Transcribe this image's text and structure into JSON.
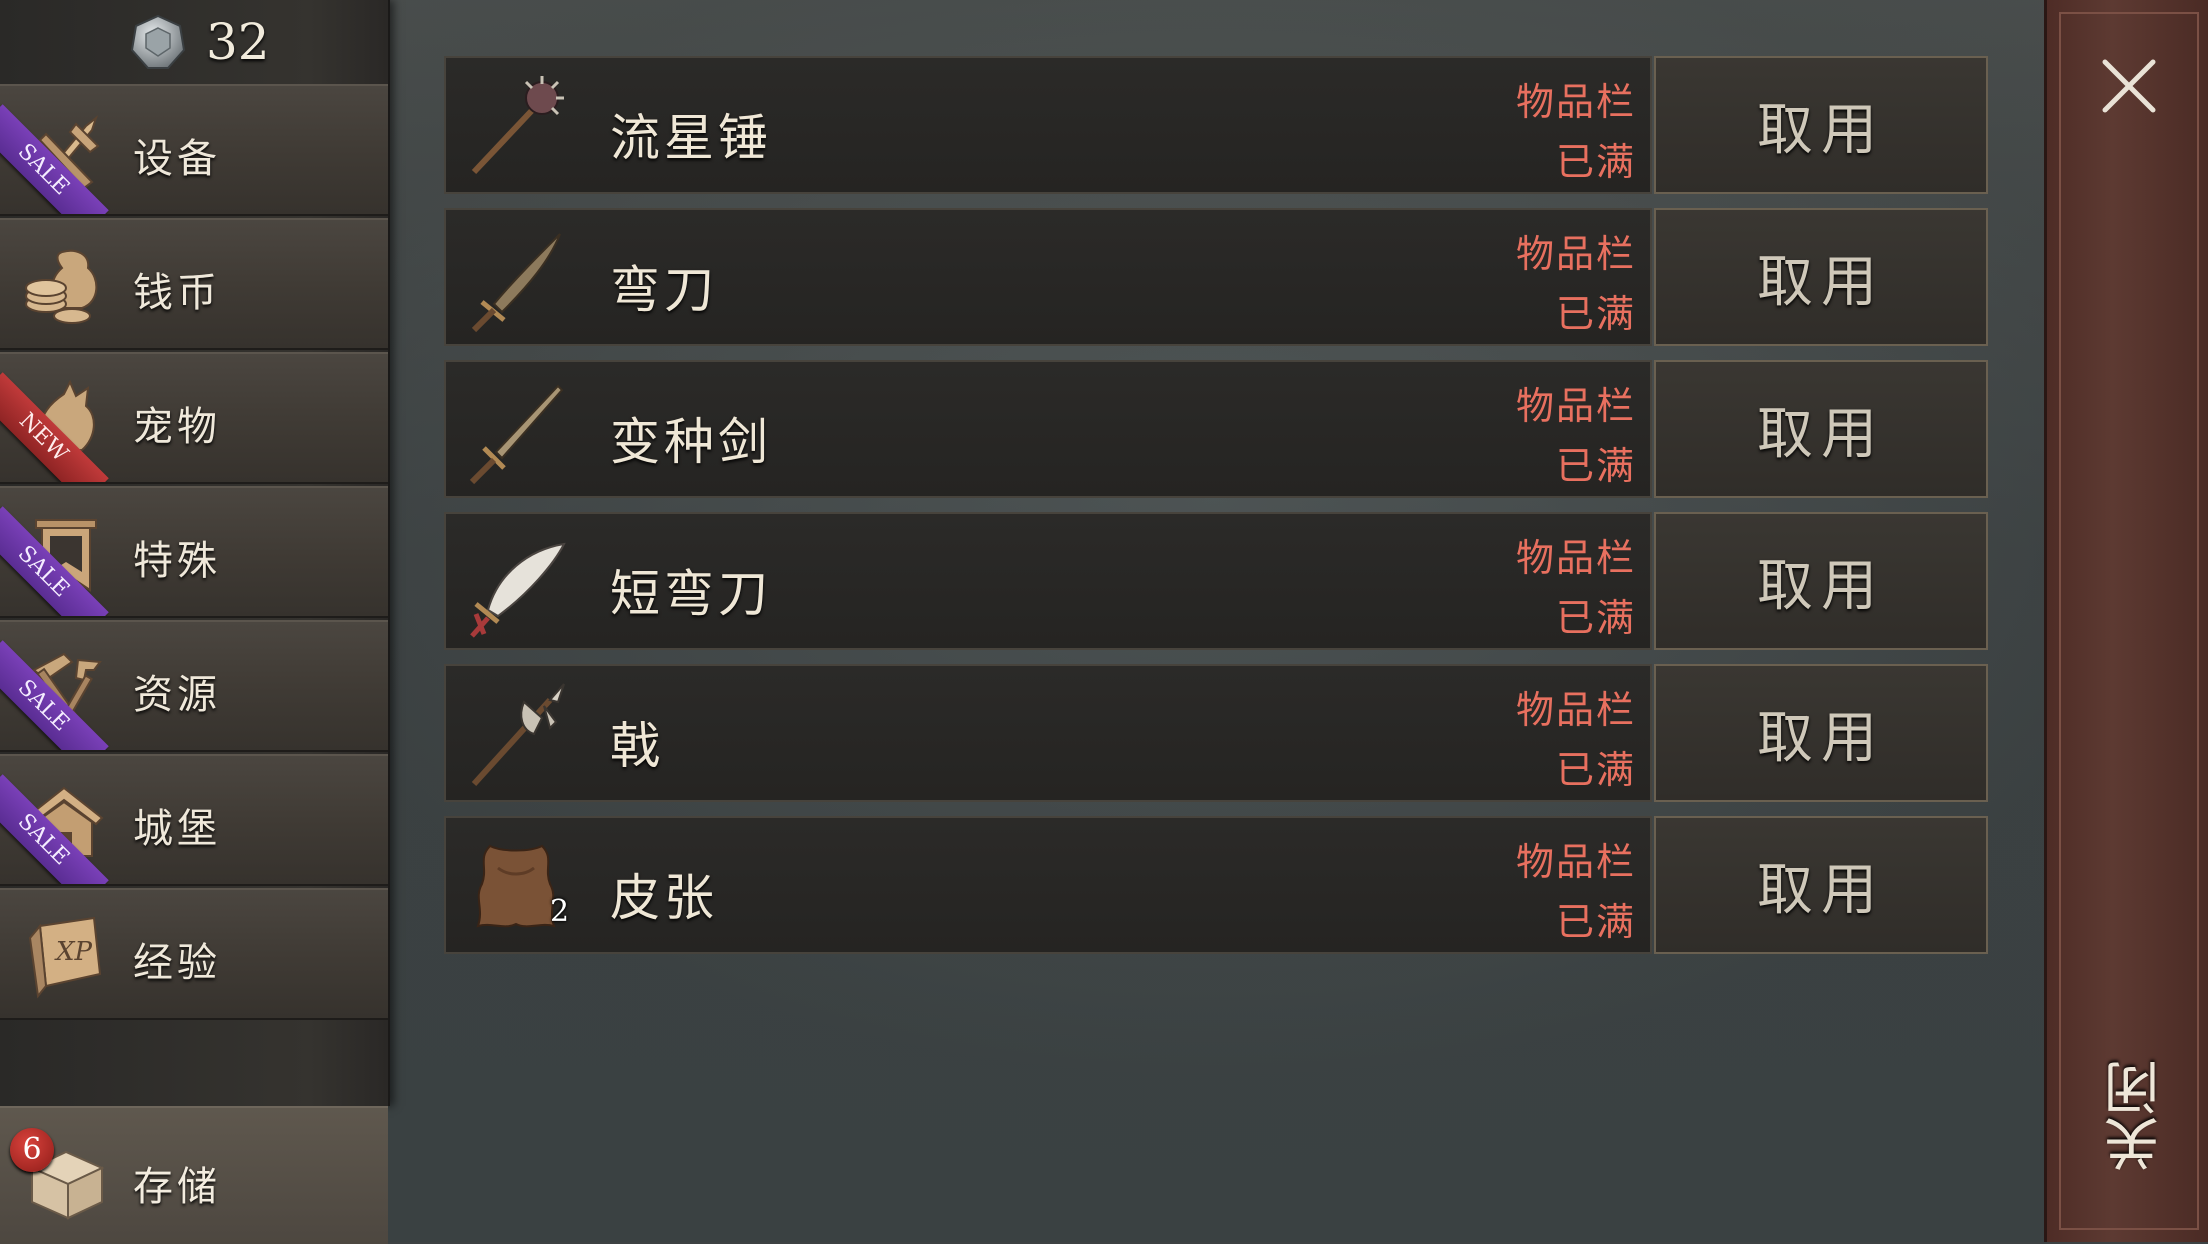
{
  "currency": {
    "value": "32",
    "icon": "gem-coin-icon"
  },
  "sidebar": {
    "items": [
      {
        "label": "设备",
        "icon": "weapons-icon",
        "ribbon": "SALE"
      },
      {
        "label": "钱币",
        "icon": "coins-icon",
        "ribbon": ""
      },
      {
        "label": "宠物",
        "icon": "pet-icon",
        "ribbon": "NEW"
      },
      {
        "label": "特殊",
        "icon": "banner-icon",
        "ribbon": "SALE"
      },
      {
        "label": "资源",
        "icon": "tools-icon",
        "ribbon": "SALE"
      },
      {
        "label": "城堡",
        "icon": "castle-icon",
        "ribbon": "SALE"
      },
      {
        "label": "经验",
        "icon": "xp-book-icon",
        "ribbon": ""
      }
    ],
    "storage": {
      "label": "存储",
      "badge": "6",
      "icon": "chest-icon"
    }
  },
  "items": [
    {
      "name": "流星锤",
      "status_line1": "物品栏",
      "status_line2": "已满",
      "button": "取用",
      "icon": "mace-icon",
      "qty": ""
    },
    {
      "name": "弯刀",
      "status_line1": "物品栏",
      "status_line2": "已满",
      "button": "取用",
      "icon": "sabre-icon",
      "qty": ""
    },
    {
      "name": "变种剑",
      "status_line1": "物品栏",
      "status_line2": "已满",
      "button": "取用",
      "icon": "sword-icon",
      "qty": ""
    },
    {
      "name": "短弯刀",
      "status_line1": "物品栏",
      "status_line2": "已满",
      "button": "取用",
      "icon": "scimitar-icon",
      "qty": ""
    },
    {
      "name": "戟",
      "status_line1": "物品栏",
      "status_line2": "已满",
      "button": "取用",
      "icon": "halberd-icon",
      "qty": ""
    },
    {
      "name": "皮张",
      "status_line1": "物品栏",
      "status_line2": "已满",
      "button": "取用",
      "icon": "hide-icon",
      "qty": "2"
    }
  ],
  "close": {
    "label": "关闭"
  },
  "colors": {
    "status_red": "#e8705f",
    "ribbon_purple": "#6a36a6",
    "ribbon_red": "#b03030",
    "close_panel": "#5a372f"
  }
}
